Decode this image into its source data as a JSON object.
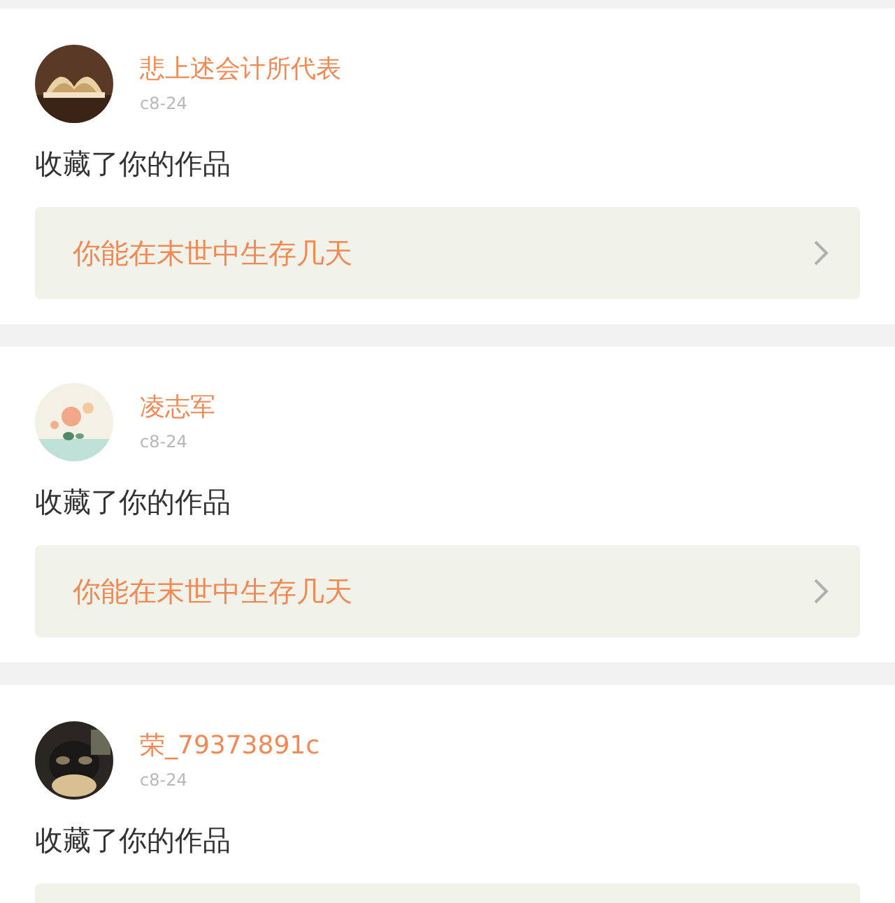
{
  "notifications": [
    {
      "user": "悲上述会计所代表",
      "date": "c8-24",
      "action": "收藏了你的作品",
      "work": "你能在末世中生存几天"
    },
    {
      "user": "凌志军",
      "date": "c8-24",
      "action": "收藏了你的作品",
      "work": "你能在末世中生存几天"
    },
    {
      "user": "荣_79373891c",
      "date": "c8-24",
      "action": "收藏了你的作品"
    }
  ]
}
